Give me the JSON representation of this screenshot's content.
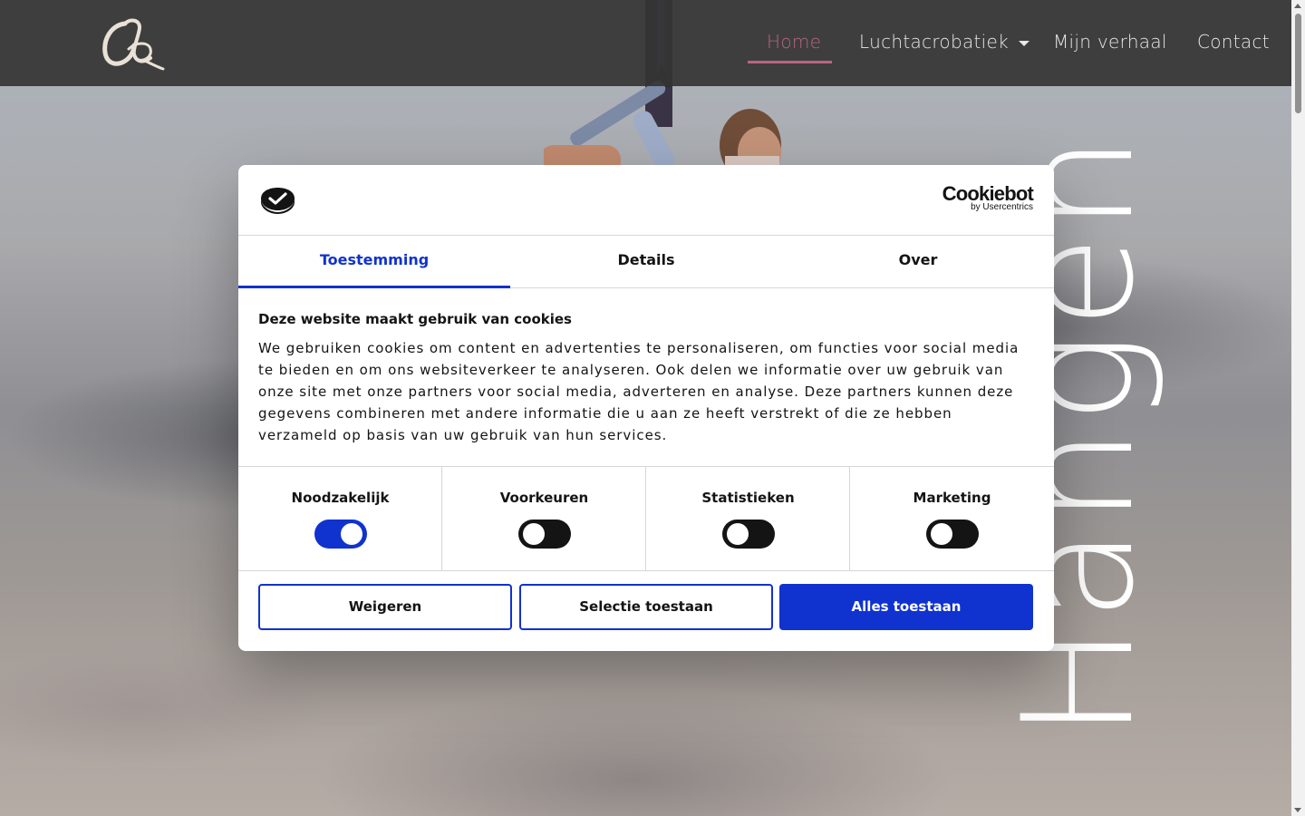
{
  "nav": {
    "items": [
      {
        "label": "Home",
        "active": true
      },
      {
        "label": "Luchtacrobatiek",
        "has_dropdown": true
      },
      {
        "label": "Mijn verhaal"
      },
      {
        "label": "Contact"
      }
    ],
    "logo_icon": "script-a-logo"
  },
  "hero": {
    "vertical_word": "Hangen"
  },
  "cookie_dialog": {
    "brand": {
      "name": "Cookiebot",
      "sub": "by Usercentrics"
    },
    "tabs": [
      {
        "label": "Toestemming",
        "active": true
      },
      {
        "label": "Details"
      },
      {
        "label": "Over"
      }
    ],
    "title": "Deze website maakt gebruik van cookies",
    "body": "We gebruiken cookies om content en advertenties te personaliseren, om functies voor social media te bieden en om ons websiteverkeer te analyseren. Ook delen we informatie over uw gebruik van onze site met onze partners voor social media, adverteren en analyse. Deze partners kunnen deze gegevens combineren met andere informatie die u aan ze heeft verstrekt of die ze hebben verzameld op basis van uw gebruik van hun services.",
    "categories": [
      {
        "label": "Noodzakelijk",
        "enabled": true
      },
      {
        "label": "Voorkeuren",
        "enabled": false
      },
      {
        "label": "Statistieken",
        "enabled": false
      },
      {
        "label": "Marketing",
        "enabled": false
      }
    ],
    "buttons": {
      "deny": "Weigeren",
      "allow_selection": "Selectie toestaan",
      "allow_all": "Alles toestaan"
    }
  },
  "colors": {
    "accent_blue": "#1032cf",
    "nav_active": "#b7657f",
    "nav_bg": "#343434"
  }
}
